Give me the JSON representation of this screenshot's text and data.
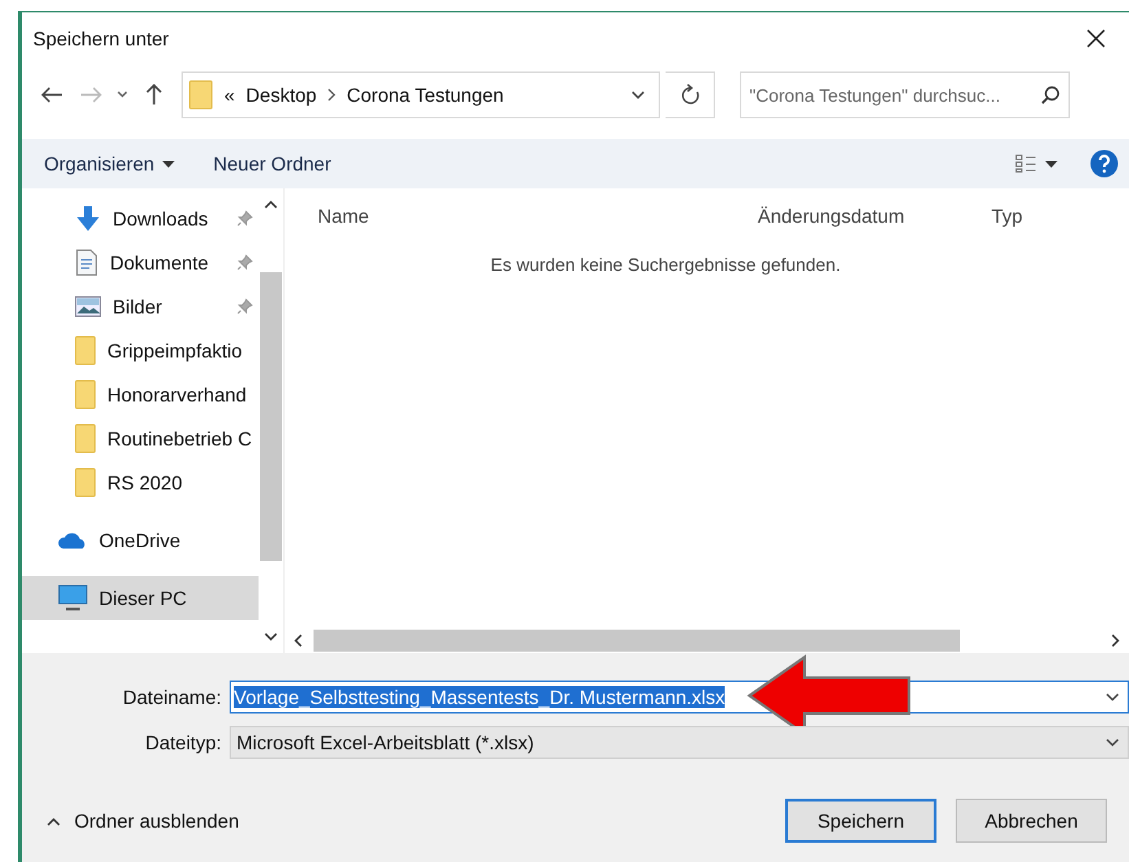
{
  "window": {
    "title": "Speichern unter"
  },
  "address": {
    "overflow": "«",
    "path": [
      "Desktop",
      "Corona Testungen"
    ]
  },
  "search": {
    "placeholder": "\"Corona Testungen\" durchsuc..."
  },
  "toolbar": {
    "organize": "Organisieren",
    "new_folder": "Neuer Ordner"
  },
  "sidebar": {
    "items": [
      {
        "label": "Downloads",
        "kind": "download",
        "pinned": true,
        "selected": false
      },
      {
        "label": "Dokumente",
        "kind": "document",
        "pinned": true,
        "selected": false
      },
      {
        "label": "Bilder",
        "kind": "pictures",
        "pinned": true,
        "selected": false
      },
      {
        "label": "Grippeimpfaktio",
        "kind": "folder",
        "pinned": false,
        "selected": false
      },
      {
        "label": "Honorarverhand",
        "kind": "folder",
        "pinned": false,
        "selected": false
      },
      {
        "label": "Routinebetrieb C",
        "kind": "folder",
        "pinned": false,
        "selected": false
      },
      {
        "label": "RS 2020",
        "kind": "folder",
        "pinned": false,
        "selected": false
      },
      {
        "label": "OneDrive",
        "kind": "cloud",
        "pinned": false,
        "selected": false
      },
      {
        "label": "Dieser PC",
        "kind": "pc",
        "pinned": false,
        "selected": true
      }
    ]
  },
  "table": {
    "columns": [
      "Name",
      "Änderungsdatum",
      "Typ"
    ],
    "empty_message": "Es wurden keine Suchergebnisse gefunden."
  },
  "filename": {
    "label": "Dateiname:",
    "value": "Vorlage_Selbsttesting_Massentests_Dr. Mustermann.xlsx"
  },
  "filetype": {
    "label": "Dateityp:",
    "value": "Microsoft Excel-Arbeitsblatt (*.xlsx)"
  },
  "hide_folders": "Ordner ausblenden",
  "buttons": [
    {
      "label": "Speichern",
      "default": true
    },
    {
      "label": "Abbrechen",
      "default": false
    }
  ]
}
